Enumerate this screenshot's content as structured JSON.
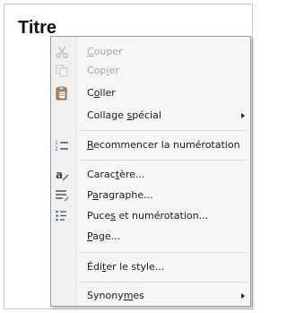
{
  "document": {
    "title": "Titre"
  },
  "menu": {
    "items": [
      {
        "pre": "",
        "acc": "C",
        "post": "ouper",
        "icon": "scissors-icon",
        "enabled": false
      },
      {
        "pre": "Cop",
        "acc": "i",
        "post": "er",
        "icon": "copy-icon",
        "enabled": false
      },
      {
        "pre": "C",
        "acc": "o",
        "post": "ller",
        "icon": "paste-icon",
        "enabled": true
      },
      {
        "pre": "Collage ",
        "acc": "s",
        "post": "pécial",
        "enabled": true,
        "submenu": true
      },
      {
        "pre": "",
        "acc": "R",
        "post": "ecommencer la numérotation",
        "icon": "restart-numbering-icon",
        "enabled": true
      },
      {
        "pre": "Carac",
        "acc": "t",
        "post": "ère...",
        "icon": "character-icon",
        "enabled": true
      },
      {
        "pre": "P",
        "acc": "a",
        "post": "ragraphe...",
        "icon": "paragraph-icon",
        "enabled": true
      },
      {
        "pre": "Puce",
        "acc": "s",
        "post": " et numérotation...",
        "icon": "bullets-numbering-icon",
        "enabled": true
      },
      {
        "pre": "",
        "acc": "P",
        "post": "age...",
        "enabled": true
      },
      {
        "pre": "Édi",
        "acc": "t",
        "post": "er le style...",
        "enabled": true
      },
      {
        "pre": "Synony",
        "acc": "m",
        "post": "es",
        "enabled": true,
        "submenu": true
      }
    ]
  }
}
